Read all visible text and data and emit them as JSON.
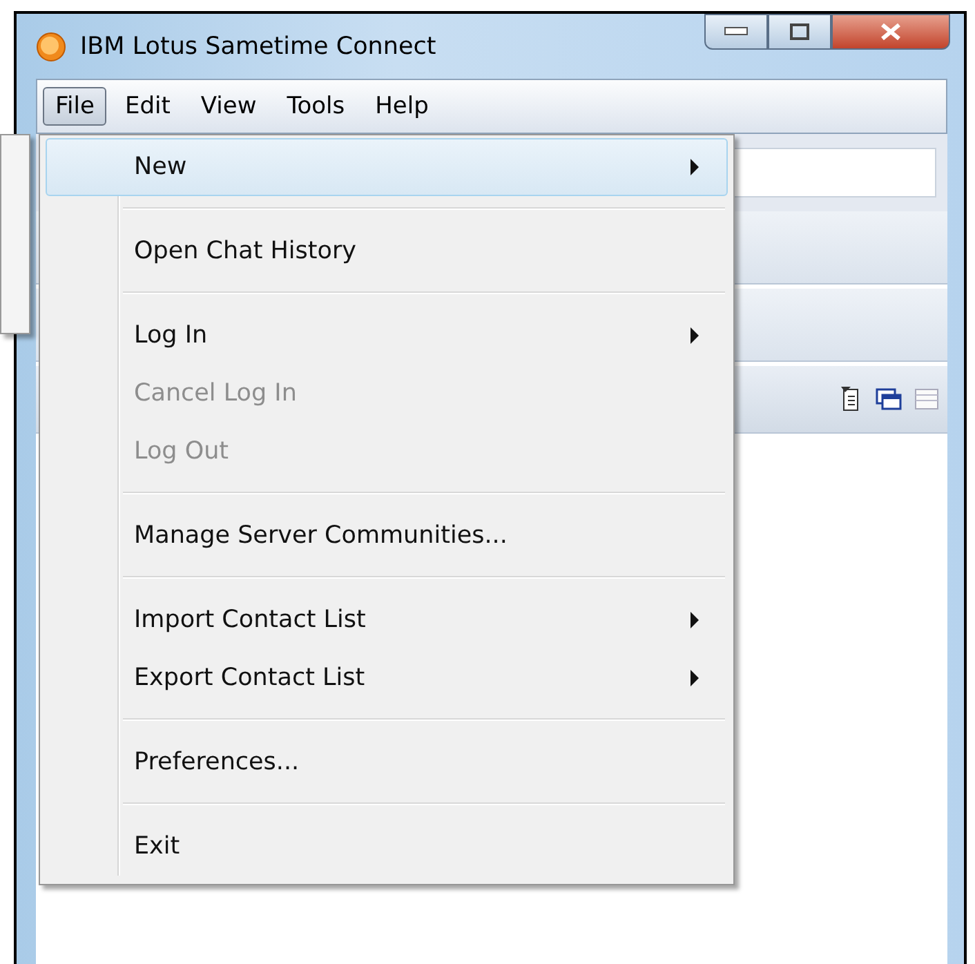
{
  "window": {
    "title": "IBM Lotus Sametime Connect"
  },
  "menu_bar": [
    {
      "label": "File",
      "selected": true
    },
    {
      "label": "Edit",
      "selected": false
    },
    {
      "label": "View",
      "selected": false
    },
    {
      "label": "Tools",
      "selected": false
    },
    {
      "label": "Help",
      "selected": false
    }
  ],
  "file_menu": [
    {
      "kind": "item",
      "label": "New",
      "submenu": true,
      "disabled": false,
      "selected": true
    },
    {
      "kind": "separator"
    },
    {
      "kind": "item",
      "label": "Open Chat History",
      "submenu": false,
      "disabled": false,
      "selected": false
    },
    {
      "kind": "separator"
    },
    {
      "kind": "item",
      "label": "Log In",
      "submenu": true,
      "disabled": false,
      "selected": false
    },
    {
      "kind": "item",
      "label": "Cancel Log In",
      "submenu": false,
      "disabled": true,
      "selected": false
    },
    {
      "kind": "item",
      "label": "Log Out",
      "submenu": false,
      "disabled": true,
      "selected": false
    },
    {
      "kind": "separator"
    },
    {
      "kind": "item",
      "label": "Manage Server Communities...",
      "submenu": false,
      "disabled": false,
      "selected": false
    },
    {
      "kind": "separator"
    },
    {
      "kind": "item",
      "label": "Import Contact List",
      "submenu": true,
      "disabled": false,
      "selected": false
    },
    {
      "kind": "item",
      "label": "Export Contact List",
      "submenu": true,
      "disabled": false,
      "selected": false
    },
    {
      "kind": "separator"
    },
    {
      "kind": "item",
      "label": "Preferences...",
      "submenu": false,
      "disabled": false,
      "selected": false
    },
    {
      "kind": "separator"
    },
    {
      "kind": "item",
      "label": "Exit",
      "submenu": false,
      "disabled": false,
      "selected": false
    }
  ]
}
